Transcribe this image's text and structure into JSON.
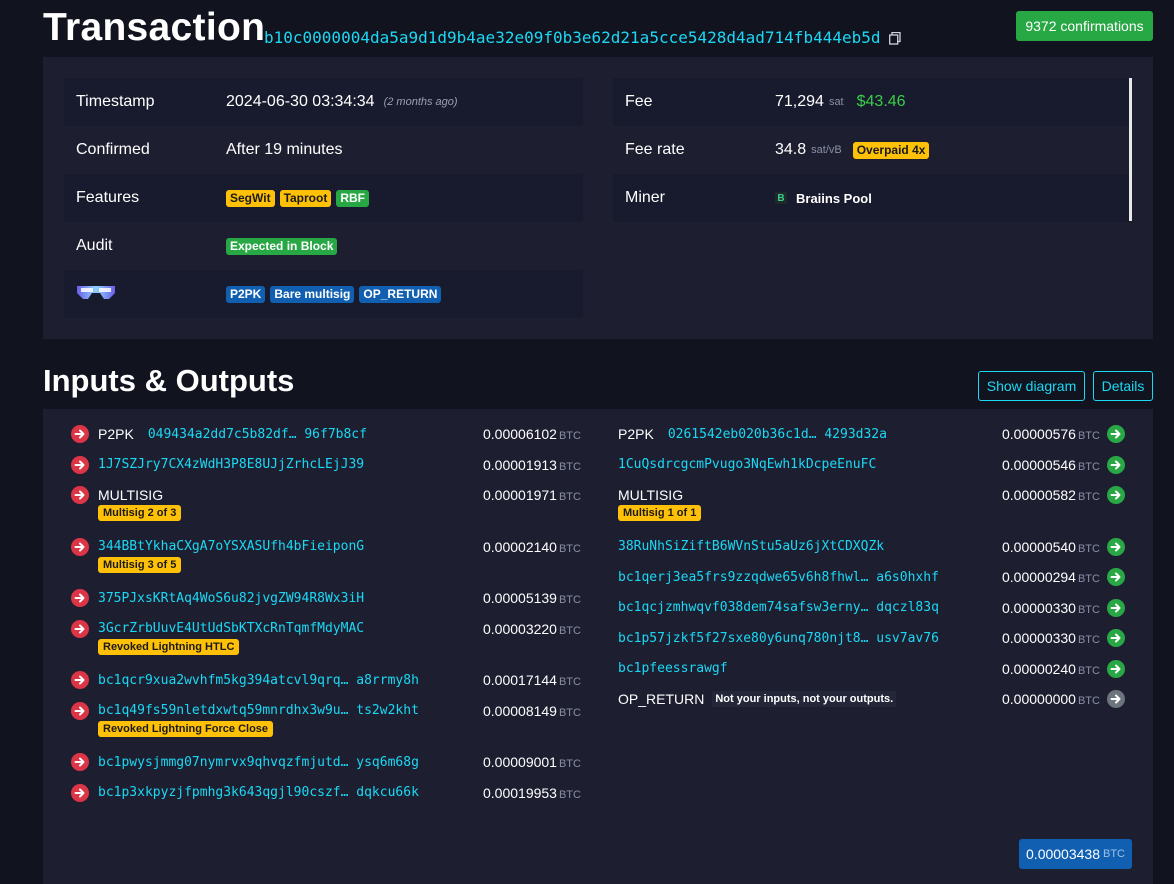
{
  "header": {
    "title": "Transaction",
    "txid": "b10c0000004da5a9d1d9b4ae32e09f0b3e62d21a5cce5428d4ad714fb444eb5d",
    "confirmations": "9372 confirmations"
  },
  "summary": {
    "timestamp_label": "Timestamp",
    "timestamp_value": "2024-06-30 03:34:34",
    "timestamp_ago": "(2 months ago)",
    "confirmed_label": "Confirmed",
    "confirmed_value": "After 19 minutes",
    "features_label": "Features",
    "features": [
      "SegWit",
      "Taproot",
      "RBF"
    ],
    "audit_label": "Audit",
    "audit_value": "Expected in Block",
    "script_tags": [
      "P2PK",
      "Bare multisig",
      "OP_RETURN"
    ],
    "fee_label": "Fee",
    "fee_sat": "71,294",
    "fee_sat_unit": "sat",
    "fee_usd": "$43.46",
    "feerate_label": "Fee rate",
    "feerate_value": "34.8",
    "feerate_unit": "sat/vB",
    "feerate_badge": "Overpaid 4x",
    "miner_label": "Miner",
    "miner_logo": "B",
    "miner_name": "Braiins Pool"
  },
  "io": {
    "title": "Inputs & Outputs",
    "show_diagram": "Show diagram",
    "details": "Details",
    "btc_unit": "BTC",
    "inputs": [
      {
        "type": "P2PK",
        "addr": "049434a2dd7c5b82df… 96f7b8cf",
        "amount": "0.00006102"
      },
      {
        "type": "",
        "addr": "1J7SZJry7CX4zWdH3P8E8UJjZrhcLEjJ39",
        "amount": "0.00001913"
      },
      {
        "type": "MULTISIG",
        "addr": "",
        "amount": "0.00001971",
        "badge": "Multisig 2 of 3"
      },
      {
        "type": "",
        "addr": "344BBtYkhaCXgA7oYSXASUfh4bFieiponG",
        "amount": "0.00002140",
        "badge": "Multisig 3 of 5"
      },
      {
        "type": "",
        "addr": "375PJxsKRtAq4WoS6u82jvgZW94R8Wx3iH",
        "amount": "0.00005139"
      },
      {
        "type": "",
        "addr": "3GcrZrbUuvE4UtUdSbKTXcRnTqmfMdyMAC",
        "amount": "0.00003220",
        "badge": "Revoked Lightning HTLC"
      },
      {
        "type": "",
        "addr": "bc1qcr9xua2wvhfm5kg394atcvl9qrq… a8rrmy8h",
        "amount": "0.00017144"
      },
      {
        "type": "",
        "addr": "bc1q49fs59nletdxwtq59mnrdhx3w9u… ts2w2kht",
        "amount": "0.00008149",
        "badge": "Revoked Lightning Force Close"
      },
      {
        "type": "",
        "addr": "bc1pwysjmmg07nymrvx9qhvqzfmjutd… ysq6m68g",
        "amount": "0.00009001"
      },
      {
        "type": "",
        "addr": "bc1p3xkpyzjfpmhg3k643qgjl90cszf… dqkcu66k",
        "amount": "0.00019953"
      }
    ],
    "outputs": [
      {
        "type": "P2PK",
        "addr": "0261542eb020b36c1d… 4293d32a",
        "amount": "0.00000576"
      },
      {
        "type": "",
        "addr": "1CuQsdrcgcmPvugo3NqEwh1kDcpeEnuFC",
        "amount": "0.00000546"
      },
      {
        "type": "MULTISIG",
        "addr": "",
        "amount": "0.00000582",
        "badge": "Multisig 1 of 1"
      },
      {
        "type": "",
        "addr": "38RuNhSiZiftB6WVnStu5aUz6jXtCDXQZk",
        "amount": "0.00000540"
      },
      {
        "type": "",
        "addr": "bc1qerj3ea5frs9zzqdwe65v6h8fhwl… a6s0hxhf",
        "amount": "0.00000294"
      },
      {
        "type": "",
        "addr": "bc1qcjzmhwqvf038dem74safsw3erny… dqczl83q",
        "amount": "0.00000330"
      },
      {
        "type": "",
        "addr": "bc1p57jzkf5f27sxe80y6unq780njt8… usv7av76",
        "amount": "0.00000330"
      },
      {
        "type": "",
        "addr": "bc1pfeessrawgf",
        "amount": "0.00000240"
      },
      {
        "type": "OP_RETURN",
        "addr": "",
        "amount": "0.00000000",
        "note": "Not your inputs, not your outputs."
      }
    ],
    "total": "0.00003438"
  }
}
